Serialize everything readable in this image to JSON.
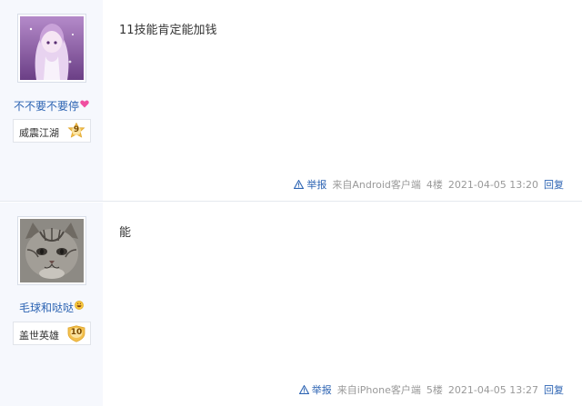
{
  "posts": [
    {
      "author": {
        "name": "不不要不要停",
        "name_emoji": "heart-emoji",
        "badge_title": "威震江湖",
        "level": "9"
      },
      "content": "11技能肯定能加钱",
      "tail": {
        "report": "举报",
        "source": "来自Android客户端",
        "floor": "4楼",
        "time": "2021-04-05 13:20",
        "reply": "回复"
      }
    },
    {
      "author": {
        "name": "毛球和哒哒",
        "name_emoji": "grin-emoji",
        "badge_title": "盖世英雄",
        "level": "10"
      },
      "content": "能",
      "tail": {
        "report": "举报",
        "source": "来自iPhone客户端",
        "floor": "5楼",
        "time": "2021-04-05 13:27",
        "reply": "回复"
      }
    }
  ],
  "colors": {
    "link": "#2d64b3",
    "sidebar_bg": "#f6f8fd",
    "muted": "#999999",
    "level_badge": "#f3c04e"
  }
}
